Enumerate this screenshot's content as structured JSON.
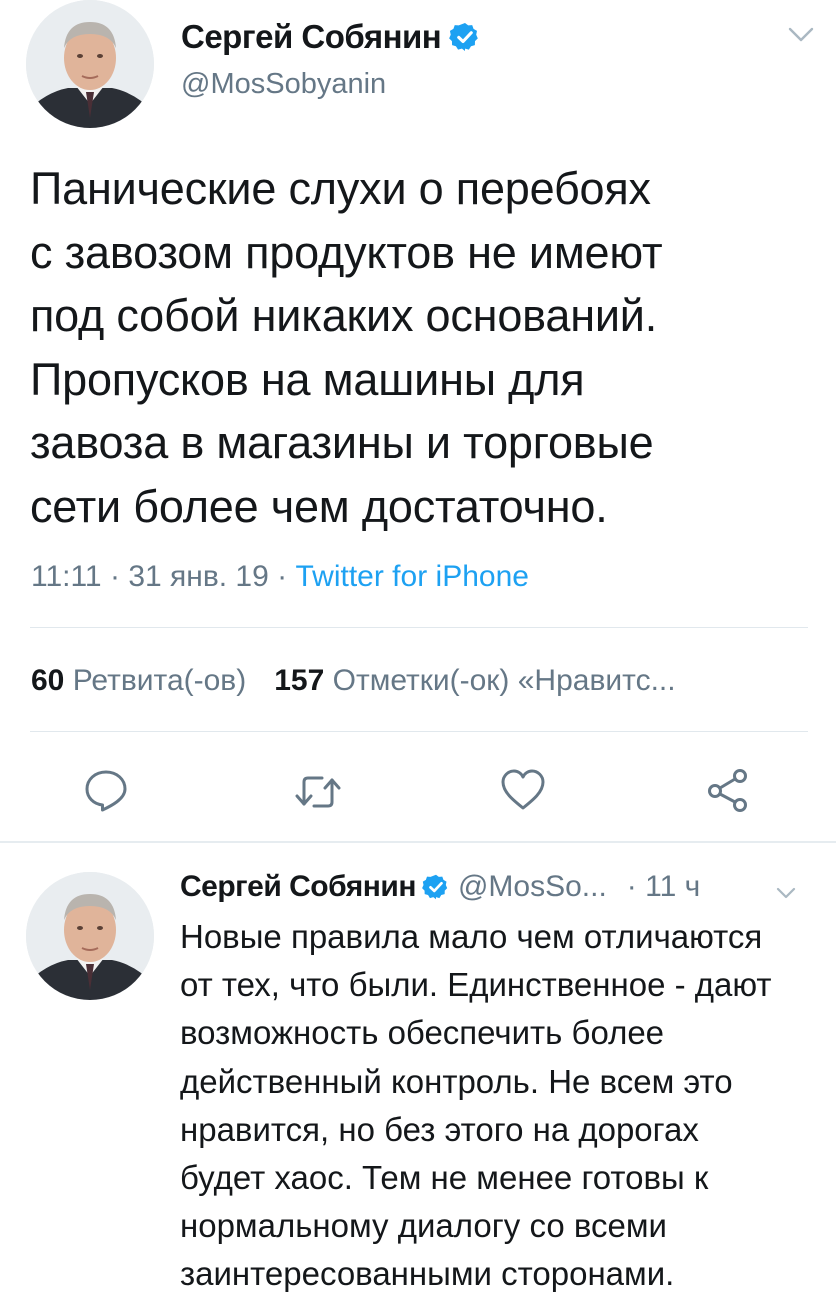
{
  "tweet": {
    "author_name": "Сергей Собянин",
    "author_handle": "@MosSobyanin",
    "text_lines": [
      "Панические слухи о перебоях",
      "с завозом продуктов не имеют",
      "под собой никаких оснований.",
      "Пропусков на машины для",
      "завоза в магазины и торговые",
      "сети более чем достаточно."
    ],
    "time": "11:11",
    "date": "31 янв. 19",
    "separator": "·",
    "source": "Twitter for iPhone",
    "retweets_count": "60",
    "retweets_label": "Ретвита(-ов)",
    "likes_count": "157",
    "likes_label": "Отметки(-ок) «Нравитс..."
  },
  "reply": {
    "author_name": "Сергей Собянин",
    "author_handle": "@MosSo...",
    "time": "· 11 ч",
    "text_lines": [
      "Новые правила мало чем отличаются",
      "от тех, что были. Единственное - дают",
      "возможность обеспечить более",
      "действенный контроль. Не всем это",
      "нравится, но без этого на дорогах",
      "будет хаос. Тем не менее готовы к",
      "нормальному диалогу со всеми",
      "заинтересованными сторонами."
    ]
  },
  "icons": {
    "verified": "verified-badge-icon",
    "menu": "chevron-down-icon",
    "reply": "reply-icon",
    "retweet": "retweet-icon",
    "like": "heart-icon",
    "share": "share-icon"
  },
  "colors": {
    "accent": "#1da1f2",
    "text": "#14171a",
    "secondary": "#657786",
    "divider": "#e1e8ed"
  }
}
